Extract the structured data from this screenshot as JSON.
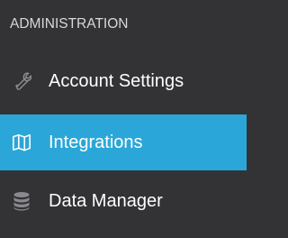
{
  "sidebar": {
    "section_title": "ADMINISTRATION",
    "items": [
      {
        "label": "Account Settings",
        "icon": "wrench-icon",
        "active": false
      },
      {
        "label": "Integrations",
        "icon": "map-icon",
        "active": true
      },
      {
        "label": "Data Manager",
        "icon": "database-icon",
        "active": false
      }
    ]
  },
  "colors": {
    "background": "#333336",
    "active_background": "#2aa7d8",
    "section_title": "#d8d8d8",
    "label": "#ffffff",
    "icon_inactive": "#8a8a8e",
    "icon_active": "#ffffff"
  }
}
